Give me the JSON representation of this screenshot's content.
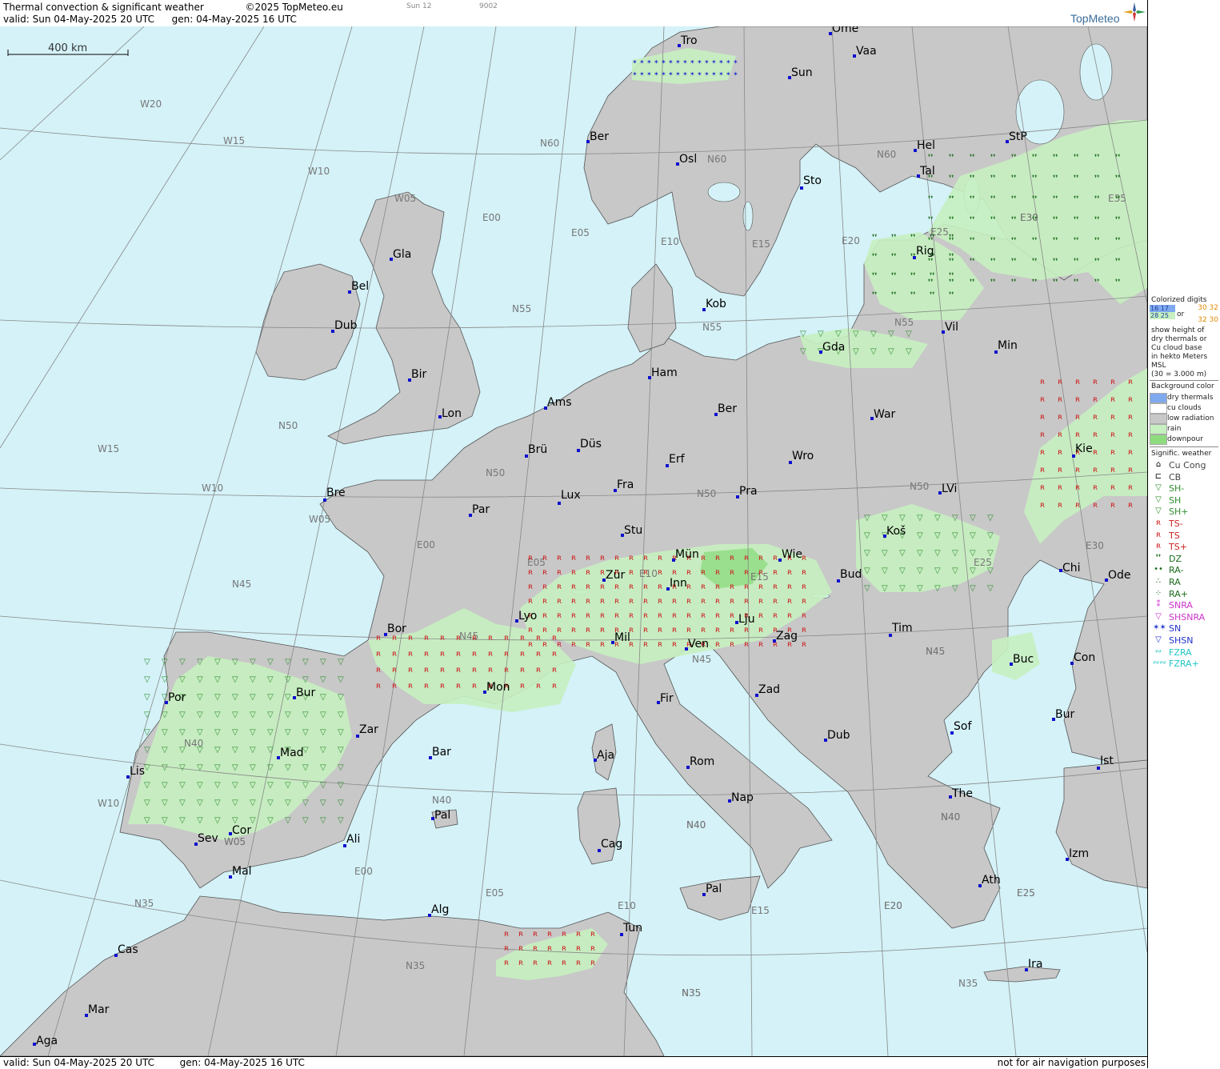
{
  "header": {
    "title": "Thermal convection & significant weather",
    "copyright": "©2025 TopMeteo.eu",
    "valid": "valid:  Sun  04-May-2025  20 UTC",
    "generated": "gen: 04-May-2025 16 UTC",
    "sunset": "Sun 12",
    "code": "9002",
    "logo": "TopMeteo"
  },
  "footer": {
    "valid": "valid:  Sun  04-May-2025  20 UTC",
    "generated": "gen: 04-May-2025 16 UTC",
    "disclaimer": "not for air navigation purposes"
  },
  "scale_label": "400 km",
  "legend": {
    "digits_title": "Colorized digits",
    "digits_a1": "16 17",
    "digits_a2": "28 25",
    "digits_or": "or",
    "digits_b1": "30 32",
    "digits_b2": "32 30",
    "digits_desc": [
      "show height of",
      "dry thermals or",
      "Cu cloud base",
      "in hekto Meters",
      "MSL",
      "(30 = 3.000 m)"
    ],
    "bg_title": "Background color",
    "bg_items": [
      {
        "label": "dry thermals",
        "color": "#7fa9ee"
      },
      {
        "label": "cu clouds",
        "color": "#ffffff"
      },
      {
        "label": "low radiation",
        "color": "#c8c8c8"
      },
      {
        "label": "rain",
        "color": "#c6f0c0"
      },
      {
        "label": "downpour",
        "color": "#8fdc7f"
      }
    ],
    "sig_title": "Signific. weather",
    "sig_items": [
      {
        "label": "Cu Cong",
        "icon": "cu-cong-icon",
        "glyph": "⌂",
        "color": "#000000"
      },
      {
        "label": "CB",
        "icon": "cb-icon",
        "glyph": "⊏",
        "color": "#000000"
      },
      {
        "label": "SH-",
        "icon": "shower-light-icon",
        "glyph": "▽",
        "color": "#2f8f2f"
      },
      {
        "label": "SH",
        "icon": "shower-icon",
        "glyph": "▽",
        "color": "#2f8f2f"
      },
      {
        "label": "SH+",
        "icon": "shower-heavy-icon",
        "glyph": "▽",
        "color": "#2f8f2f"
      },
      {
        "label": "TS-",
        "icon": "thunderstorm-light-icon",
        "glyph": "ʀ",
        "color": "#cc2020"
      },
      {
        "label": "TS",
        "icon": "thunderstorm-icon",
        "glyph": "ʀ",
        "color": "#cc2020"
      },
      {
        "label": "TS+",
        "icon": "thunderstorm-heavy-icon",
        "glyph": "ʀ",
        "color": "#cc2020"
      },
      {
        "label": "DZ",
        "icon": "drizzle-icon",
        "glyph": "❜❜",
        "color": "#1a6b1a"
      },
      {
        "label": "RA-",
        "icon": "rain-light-icon",
        "glyph": "••",
        "color": "#1a6b1a"
      },
      {
        "label": "RA",
        "icon": "rain-icon",
        "glyph": "∴",
        "color": "#1a6b1a"
      },
      {
        "label": "RA+",
        "icon": "rain-heavy-icon",
        "glyph": "⁘",
        "color": "#1a6b1a"
      },
      {
        "label": "SNRA",
        "icon": "snow-rain-icon",
        "glyph": "⁑",
        "color": "#cc33cc"
      },
      {
        "label": "SHSNRA",
        "icon": "snow-rain-shower-icon",
        "glyph": "▽",
        "color": "#cc33cc"
      },
      {
        "label": "SN",
        "icon": "snow-icon",
        "glyph": "✶✶",
        "color": "#2233cc"
      },
      {
        "label": "SHSN",
        "icon": "snow-shower-icon",
        "glyph": "▽",
        "color": "#2233cc"
      },
      {
        "label": "FZRA",
        "icon": "freezing-rain-icon",
        "glyph": "∾",
        "color": "#22c6c6"
      },
      {
        "label": "FZRA+",
        "icon": "freezing-rain-heavy-icon",
        "glyph": "∾∾",
        "color": "#22c6c6"
      }
    ]
  },
  "grid_labels": [
    "W20",
    "W15",
    "W10",
    "W05",
    "E00",
    "E05",
    "E10",
    "E15",
    "E20",
    "E25",
    "E30",
    "E35",
    "N60",
    "N55",
    "N50",
    "N45",
    "N40",
    "N35",
    "W15",
    "W10",
    "W05",
    "E00",
    "E05",
    "E10",
    "E15",
    "N55",
    "N50",
    "N45",
    "N40",
    "N35",
    "N60",
    "N55",
    "N50",
    "N45",
    "N40",
    "N35",
    "E20",
    "E25",
    "E30",
    "N60",
    "N50",
    "N45",
    "N40",
    "N35",
    "E30",
    "E25",
    "W05",
    "N40",
    "W10",
    "W05",
    "E00",
    "E05",
    "E10",
    "E15",
    "E20",
    "E25",
    "N45",
    "N40",
    "N35"
  ],
  "cities": [
    "Tro",
    "Ome",
    "Vaa",
    "Sun",
    "Ber",
    "Osl",
    "Hel",
    "StP",
    "Tal",
    "Sto",
    "Gla",
    "Bel",
    "Rig",
    "Kob",
    "Dub",
    "Vil",
    "Min",
    "Gda",
    "Ham",
    "Bir",
    "Ams",
    "Lon",
    "Ber",
    "War",
    "Kie",
    "Brü",
    "Düs",
    "Erf",
    "Wro",
    "Bre",
    "Par",
    "Fra",
    "Lux",
    "Pra",
    "LVi",
    "Stu",
    "Koš",
    "Mün",
    "Wie",
    "Chi",
    "Ode",
    "Zür",
    "Inn",
    "Bud",
    "Lyo",
    "Lju",
    "Tim",
    "Bor",
    "Mil",
    "Ven",
    "Zag",
    "Buc",
    "Con",
    "Bur",
    "Por",
    "Mon",
    "Fir",
    "Zad",
    "Zar",
    "Sof",
    "Bur",
    "Dub",
    "Lis",
    "Mad",
    "Aja",
    "Bar",
    "Rom",
    "Ist",
    "Nap",
    "The",
    "Pal",
    "Sev",
    "Cor",
    "Ali",
    "Cag",
    "Izm",
    "Mal",
    "Ath",
    "Pal",
    "Alg",
    "Tun",
    "Cas",
    "Ira",
    "Mar",
    "Aga"
  ]
}
